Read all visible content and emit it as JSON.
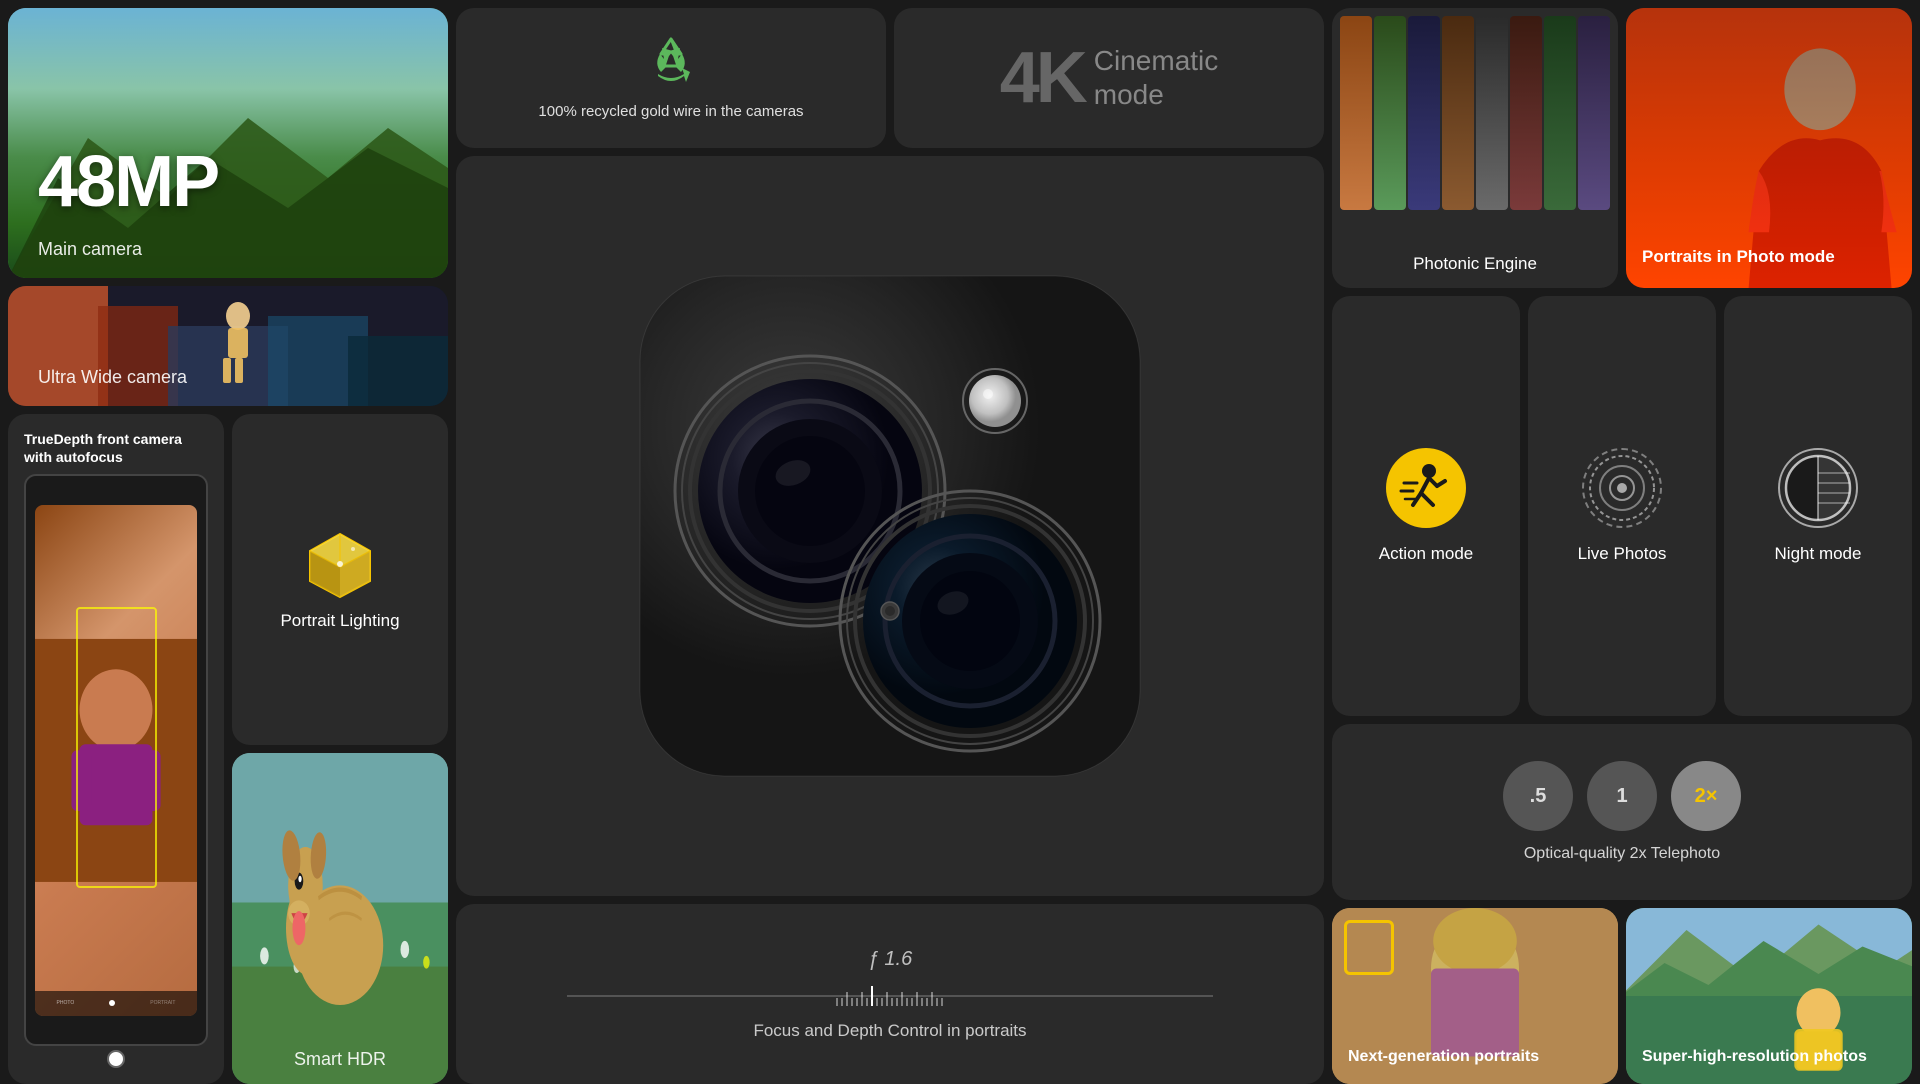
{
  "left": {
    "main_camera": {
      "mp": "48MP",
      "label": "Main camera"
    },
    "ultra_wide": {
      "label": "Ultra Wide camera"
    },
    "truedepth": {
      "title": "TrueDepth front camera with autofocus"
    },
    "portrait_lighting": {
      "label": "Portrait Lighting"
    },
    "smart_hdr": {
      "label": "Smart HDR"
    }
  },
  "center": {
    "recycled": {
      "text": "100% recycled gold wire in the cameras"
    },
    "cinematic": {
      "k": "4K",
      "mode": "Cinematic",
      "mode2": "mode"
    },
    "focus": {
      "aperture": "ƒ 1.6",
      "label": "Focus and Depth Control in portraits"
    }
  },
  "right": {
    "photonic": {
      "label": "Photonic Engine"
    },
    "portraits": {
      "label": "Portraits in Photo mode"
    },
    "action": {
      "label": "Action mode"
    },
    "live": {
      "label": "Live Photos"
    },
    "night": {
      "label": "Night mode"
    },
    "telephoto": {
      "zoom_05": ".5",
      "zoom_1": "1",
      "zoom_2": "2×",
      "label": "Optical-quality 2x Telephoto"
    },
    "next_gen": {
      "label": "Next-generation portraits"
    },
    "super_hq": {
      "label": "Super-high-resolution photos"
    }
  }
}
